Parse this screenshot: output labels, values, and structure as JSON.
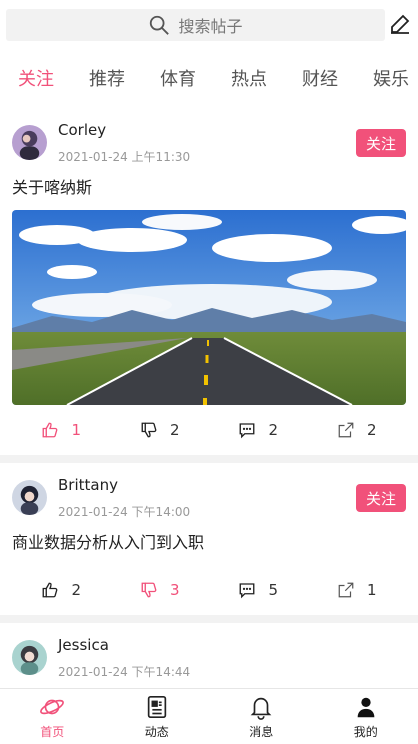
{
  "search": {
    "placeholder": "搜索帖子"
  },
  "tabs": [
    "关注",
    "推荐",
    "体育",
    "热点",
    "财经",
    "娱乐"
  ],
  "posts": [
    {
      "author": "Corley",
      "time": "2021-01-24 上午11:30",
      "follow": "关注",
      "title": "关于喀纳斯",
      "likes": "1",
      "dislikes": "2",
      "comments": "2",
      "shares": "2"
    },
    {
      "author": "Brittany",
      "time": "2021-01-24 下午14:00",
      "follow": "关注",
      "title": "商业数据分析从入门到入职",
      "likes": "2",
      "dislikes": "3",
      "comments": "5",
      "shares": "1"
    },
    {
      "author": "Jessica",
      "time": "2021-01-24 下午14:44"
    }
  ],
  "nav": [
    "首页",
    "动态",
    "消息",
    "我的"
  ],
  "colors": {
    "accent": "#f1517a"
  }
}
